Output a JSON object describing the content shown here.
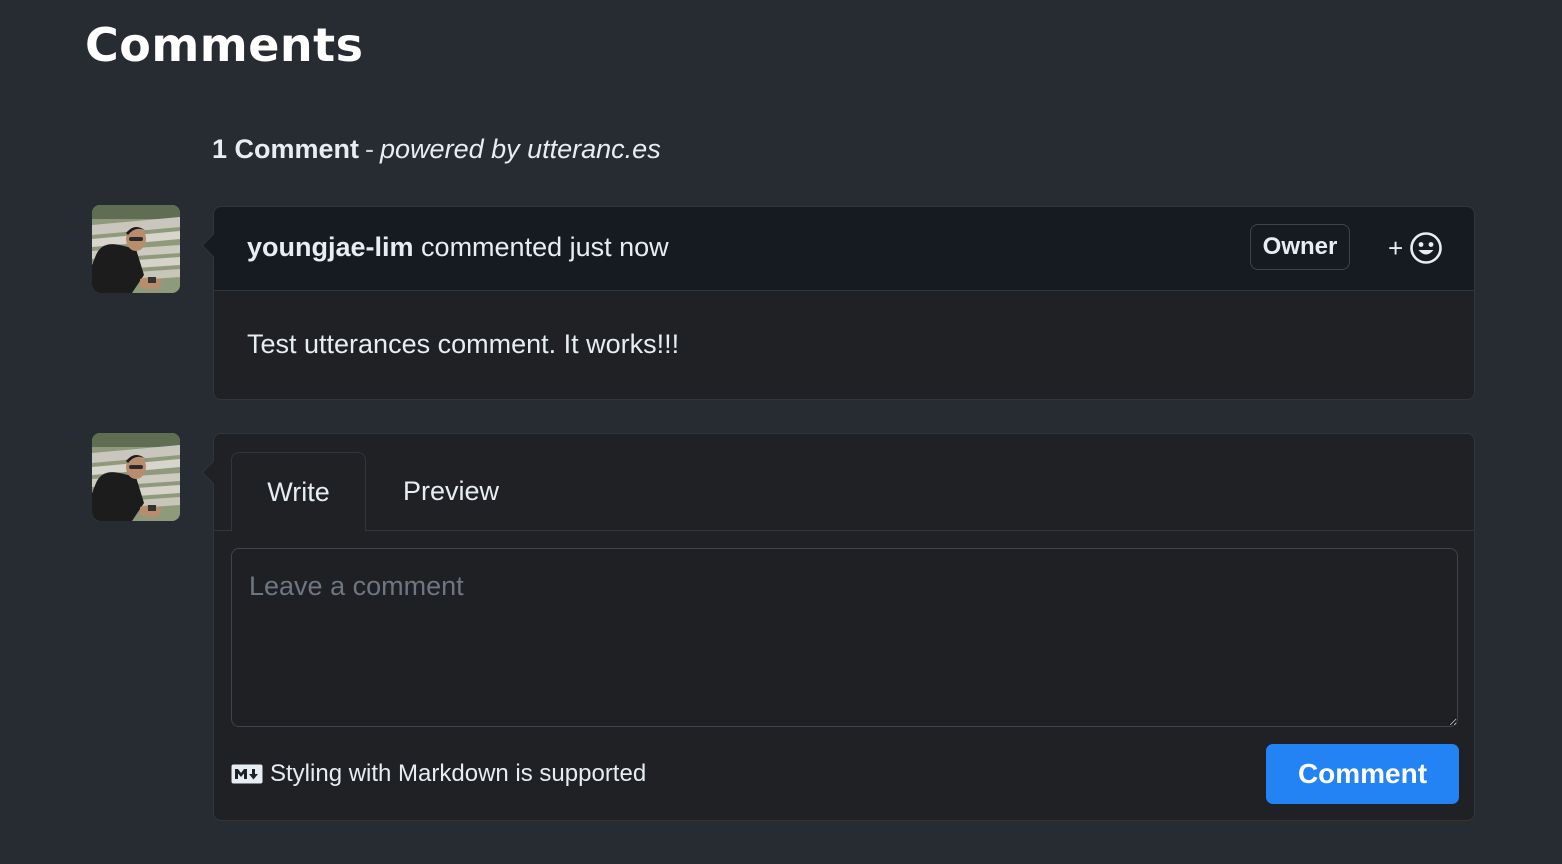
{
  "page": {
    "title": "Comments"
  },
  "thread": {
    "count_label": "1 Comment",
    "separator": "-",
    "powered_by": "powered by utteranc.es"
  },
  "comments": [
    {
      "author": "youngjae-lim",
      "meta": "commented just now",
      "badge": "Owner",
      "reaction_plus": "+",
      "reaction_icon": "smiley-icon",
      "body": "Test utterances comment. It works!!!"
    }
  ],
  "composer": {
    "tabs": [
      {
        "label": "Write",
        "selected": true
      },
      {
        "label": "Preview",
        "selected": false
      }
    ],
    "placeholder": "Leave a comment",
    "value": "",
    "markdown_note": "Styling with Markdown is supported",
    "markdown_icon": "markdown-icon",
    "submit_label": "Comment"
  },
  "colors": {
    "background": "#272c33",
    "card_background": "#202124",
    "header_background": "#161b22",
    "border": "#30363d",
    "primary_button": "#2383f5"
  }
}
